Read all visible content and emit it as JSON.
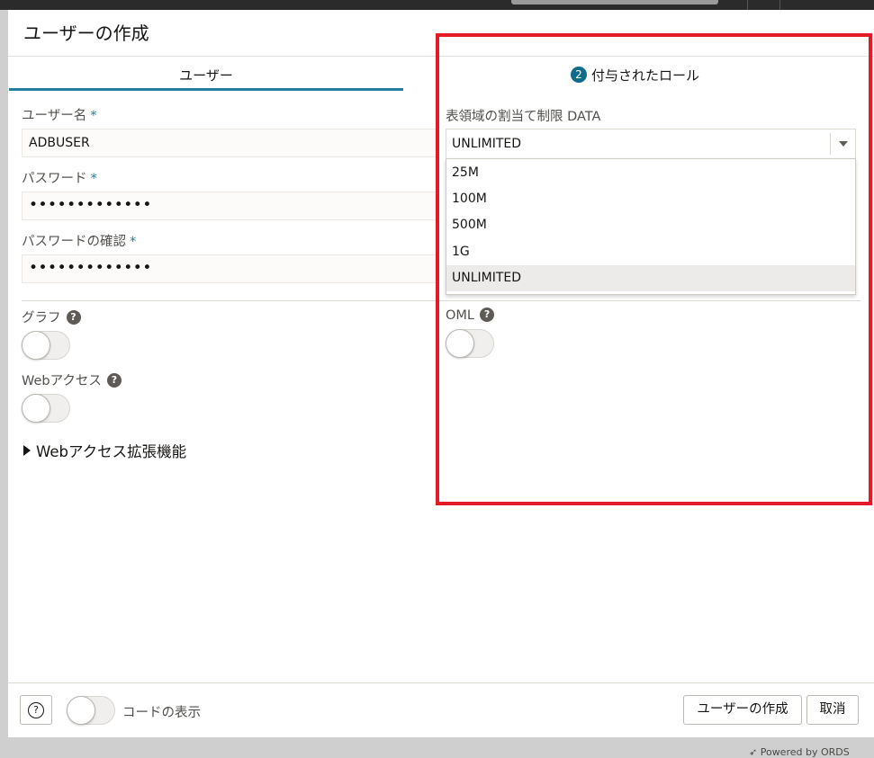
{
  "dialog": {
    "title": "ユーザーの作成",
    "tabs": [
      {
        "label": "ユーザー"
      },
      {
        "badge": "2",
        "label": "付与されたロール"
      }
    ]
  },
  "user_tab": {
    "username": {
      "label": "ユーザー名",
      "required_mark": "*",
      "value": "ADBUSER"
    },
    "password": {
      "label": "パスワード",
      "required_mark": "*",
      "value": "•••••••••••••"
    },
    "password_confirm": {
      "label": "パスワードの確認",
      "required_mark": "*",
      "value": "•••••••••••••"
    },
    "graph": {
      "label": "グラフ",
      "help": "?",
      "enabled": false
    },
    "web_access": {
      "label": "Webアクセス",
      "help": "?",
      "enabled": false
    },
    "web_access_ext": {
      "label": "Webアクセス拡張機能"
    }
  },
  "quota": {
    "label": "表領域の割当て制限 DATA",
    "selected": "UNLIMITED",
    "options": [
      "25M",
      "100M",
      "500M",
      "1G",
      "UNLIMITED"
    ]
  },
  "oml": {
    "label": "OML",
    "help": "?",
    "enabled": false
  },
  "footer": {
    "help_glyph": "?",
    "show_code_label": "コードの表示",
    "show_code_enabled": false,
    "create_button": "ユーザーの作成",
    "cancel_button": "取消"
  },
  "powered_by": "Powered by ORDS",
  "colors": {
    "accent": "#227e9e",
    "badge": "#0f6c8d",
    "highlight_box": "#e41b24"
  }
}
